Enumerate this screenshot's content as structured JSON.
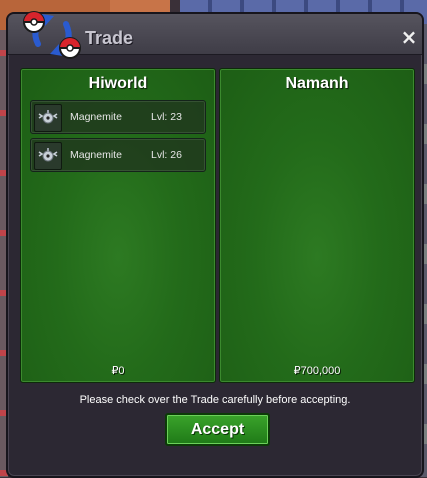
{
  "window": {
    "title": "Trade",
    "close_label": "×"
  },
  "left_panel": {
    "player": "Hiworld",
    "money": "₽0",
    "pokemon": [
      {
        "name": "Magnemite",
        "level": "Lvl: 23"
      },
      {
        "name": "Magnemite",
        "level": "Lvl: 26"
      }
    ]
  },
  "right_panel": {
    "player": "Namanh",
    "money": "₽700,000"
  },
  "note": "Please check over the Trade carefully before accepting.",
  "accept_label": "Accept",
  "colors": {
    "panel_green": "#236b1a",
    "accept_green": "#2f8f23",
    "window_bg": "#2c2833"
  },
  "icons": [
    "pokeball-logo-icon",
    "close-icon",
    "magnemite-icon"
  ]
}
